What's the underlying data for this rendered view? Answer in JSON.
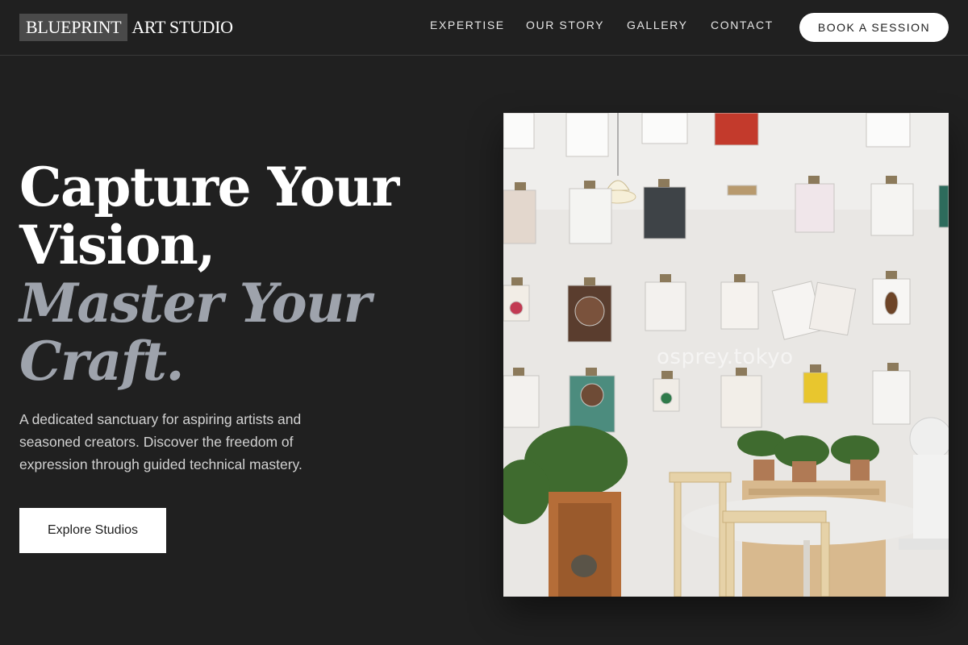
{
  "header": {
    "logo_boxed": "BLUEPRINT",
    "logo_rest": "ART STUDIO",
    "nav": [
      "EXPERTISE",
      "OUR STORY",
      "GALLERY",
      "CONTACT"
    ],
    "cta": "BOOK A SESSION"
  },
  "hero": {
    "headline_line1": "Capture Your",
    "headline_line2": "Vision,",
    "accent_line1": "Master Your",
    "accent_line2": "Craft.",
    "description": "A dedicated sanctuary for aspiring artists and seasoned creators. Discover the freedom of expression through guided technical mastery.",
    "cta": "Explore Studios"
  },
  "image": {
    "watermark": "osprey.tokyo"
  },
  "colors": {
    "background": "#202020",
    "accent_text": "#9ea3ac",
    "button_bg": "#ffffff",
    "logo_box": "#4a4a4a"
  }
}
